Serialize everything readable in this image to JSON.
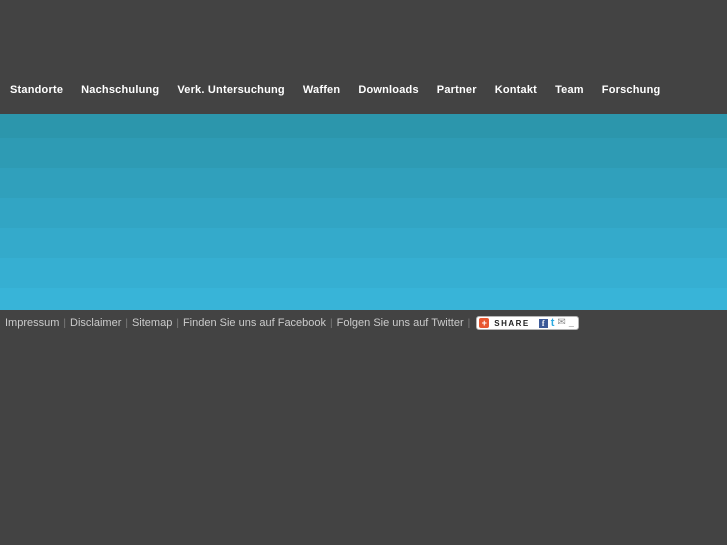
{
  "colors": {
    "background": "#434343",
    "nav_text": "#ffffff",
    "footer_text": "#cbcbcb",
    "addthis_orange": "#e8562f",
    "facebook_blue": "#3b5998",
    "twitter_blue": "#2daae1",
    "banner_bands": [
      "#2c96ac",
      "#2e9bb4",
      "#30a0bc",
      "#32a5c4",
      "#34aacb",
      "#36afd2",
      "#38b4d8"
    ]
  },
  "nav": {
    "items": [
      {
        "label": "Standorte"
      },
      {
        "label": "Nachschulung"
      },
      {
        "label": "Verk. Untersuchung"
      },
      {
        "label": "Waffen"
      },
      {
        "label": "Downloads"
      },
      {
        "label": "Partner"
      },
      {
        "label": "Kontakt"
      },
      {
        "label": "Team"
      },
      {
        "label": "Forschung"
      }
    ]
  },
  "footer": {
    "separator": "|",
    "links": [
      {
        "label": "Impressum"
      },
      {
        "label": "Disclaimer"
      },
      {
        "label": "Sitemap"
      },
      {
        "label": "Finden Sie uns auf Facebook"
      },
      {
        "label": "Folgen Sie uns auf Twitter"
      }
    ],
    "share": {
      "label": "SHARE",
      "plus_icon": "+",
      "facebook_icon": "f",
      "twitter_icon": "t",
      "email_icon": "✉",
      "more_icon": "_"
    }
  }
}
